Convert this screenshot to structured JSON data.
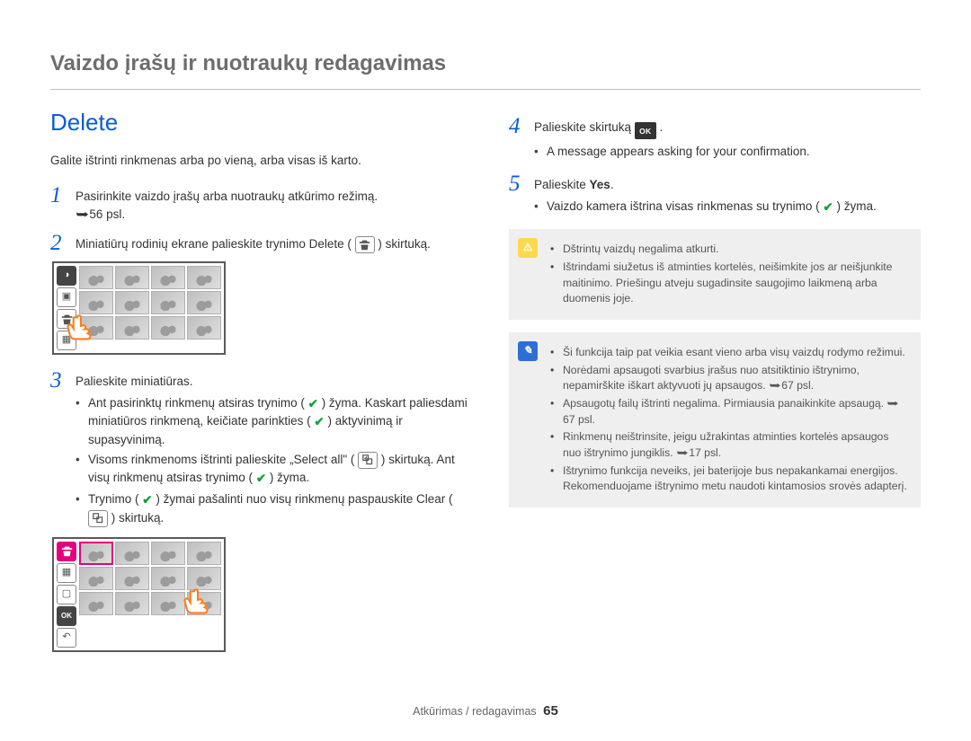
{
  "chapter": {
    "title": "Vaizdo įrašų ir nuotraukų redagavimas"
  },
  "section": {
    "title": "Delete"
  },
  "intro": "Galite ištrinti rinkmenas arba po vieną, arba visas iš kartо.",
  "steps": {
    "s1": {
      "text": "Pasirinkite vaizdo įrašų arba nuotraukų atkūrimo režimą.",
      "ref": "56 psl."
    },
    "s2": {
      "pre": "Miniatiūrų rodinių ekrane palieskite trynimo Delete (",
      "post": ") skirtuką."
    },
    "s3": {
      "title": "Palieskite miniatiūras.",
      "b1_pre": "Ant pasirinktų rinkmenų atsiras trynimo (",
      "b1_mid": ") žyma. Kaskart paliesdami miniatiūros rinkmeną, keičiate parinkties (",
      "b1_post": ") aktyvinimą ir supasyvinimą.",
      "b2_pre": "Visoms rinkmenoms ištrinti palieskite „Select all\" (",
      "b2_mid": ") skirtuką. Ant visų rinkmenų atsiras trynimo (",
      "b2_post": ") žyma.",
      "b3_pre": "Trynimo (",
      "b3_mid": ") žymai pašalinti nuo visų rinkmenų paspauskite Clear (",
      "b3_post": ") skirtuką."
    },
    "s4": {
      "title": "Palieskite skirtuką ",
      "ok": "OK",
      "b1": "A message appears asking for your confirmation."
    },
    "s5": {
      "title_pre": "Palieskite ",
      "yes": "Yes",
      "b1_pre": "Vaizdo kamera ištrina visas rinkmenas su trynimo (",
      "b1_post": ") žyma."
    }
  },
  "notice_warn": {
    "b1": "Dštrintų vaizdų negalima atkurti.",
    "b2": "Ištrindami siužetus iš atminties kortelės, neišimkite jos ar neišjunkite maitinimo. Priešingu atveju sugadinsite saugojimo laikmeną arba duomenis joje."
  },
  "notice_info": {
    "b1": "Ši funkcija taip pat veikia esant vieno arba visų vaizdų rodymo režimui.",
    "b2_pre": "Norėdami apsaugoti svarbius įrašus nuo atsitiktinio ištrynimo, nepamirškite iškart aktyvuoti jų apsaugos.",
    "b2_ref": "67 psl.",
    "b3_pre": "Apsaugotų failų ištrinti negalima. Pirmiausia panaikinkite apsaugą.",
    "b3_ref": "67 psl.",
    "b4_pre": "Rinkmenų neištrinsite, jeigu užrakintas atminties kortelės apsaugos nuo ištrynimo jungiklis.",
    "b4_ref": "17 psl.",
    "b5": "Ištrynimo funkcija neveiks, jei baterijoje bus nepakankamai energijos. Rekomenduojame ištrynimo metu naudoti kintamosios srovės adapterį."
  },
  "footer": {
    "section": "Atkūrimas / redagavimas",
    "page": "65"
  }
}
